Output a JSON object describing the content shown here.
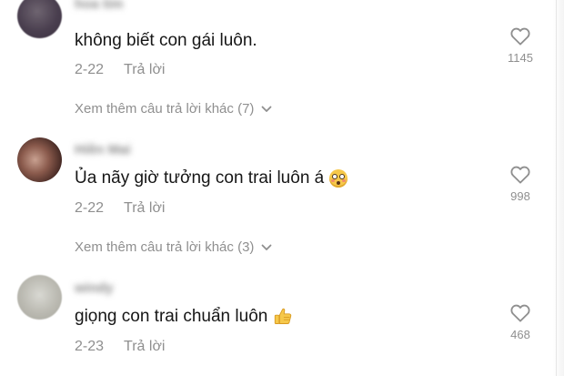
{
  "comments": [
    {
      "username": "hoa tim",
      "text": "không biết con gái luôn.",
      "emoji": "",
      "date": "2-22",
      "reply_label": "Trả lời",
      "like_count": "1145"
    },
    {
      "username": "Hiền Mai",
      "text": "Ủa nãy giờ tưởng con trai luôn á",
      "emoji": "flushed-face",
      "date": "2-22",
      "reply_label": "Trả lời",
      "like_count": "998"
    },
    {
      "username": "windy",
      "text": "giọng con trai chuẩn luôn",
      "emoji": "thumbs-up",
      "date": "2-23",
      "reply_label": "Trả lời",
      "like_count": "468"
    }
  ],
  "more_replies": [
    {
      "label": "Xem thêm câu trả lời khác (7)"
    },
    {
      "label": "Xem thêm câu trả lời khác (3)"
    }
  ],
  "colors": {
    "text": "#161616",
    "muted": "#8f8f8f",
    "background": "#ffffff"
  }
}
